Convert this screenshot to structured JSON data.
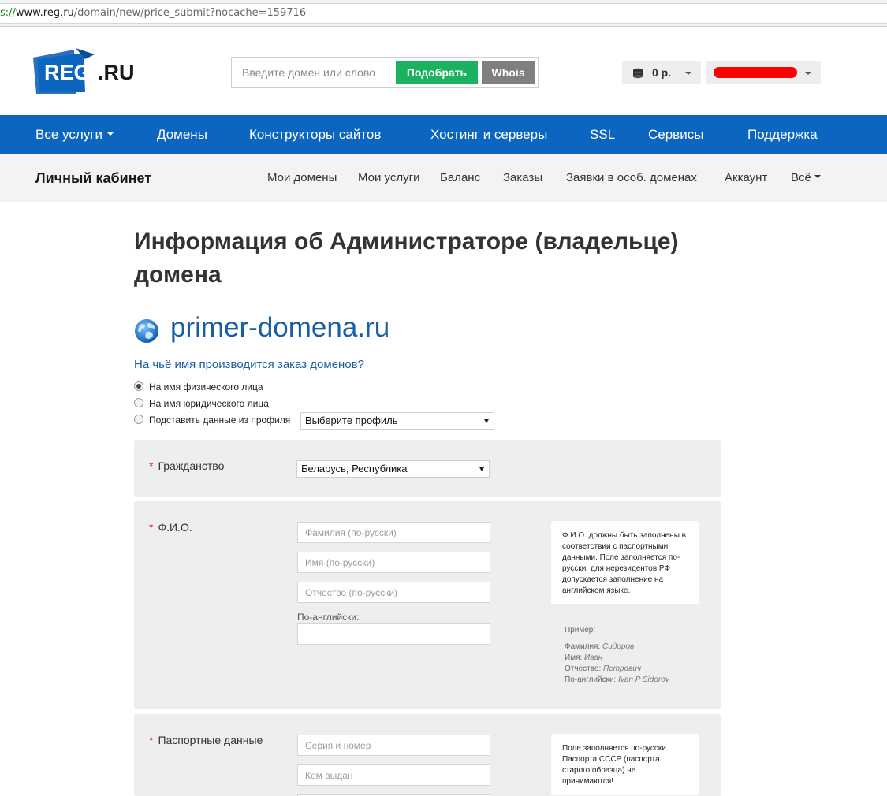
{
  "browser": {
    "url_scheme": "s://",
    "url_host": "www.reg.ru",
    "url_path": "/domain/new/price_submit?nocache=159716"
  },
  "header": {
    "logo_reg": "REG",
    "logo_ru": ".RU",
    "search_placeholder": "Введите домен или слово",
    "pick_button": "Подобрать",
    "whois_button": "Whois",
    "balance": "0 р."
  },
  "nav": {
    "items": [
      "Все услуги",
      "Домены",
      "Конструкторы сайтов",
      "Хостинг и серверы",
      "SSL",
      "Сервисы",
      "Поддержка"
    ]
  },
  "subnav": {
    "title": "Личный кабинет",
    "links": [
      "Мои домены",
      "Мои услуги",
      "Баланс",
      "Заказы",
      "Заявки в особ. доменах",
      "Аккаунт",
      "Всё"
    ]
  },
  "page": {
    "title_line1": "Информация об Администраторе (владельце)",
    "title_line2": "домена",
    "domain": "primer-domena.ru",
    "question": "На чьё имя производится заказ доменов?"
  },
  "owner_type": {
    "options": [
      "На имя физического лица",
      "На имя юридического лица",
      "Подставить данные из профиля"
    ],
    "selected_index": 0,
    "profile_select_value": "Выберите профиль"
  },
  "citizenship": {
    "label": "Гражданство",
    "value": "Беларусь, Республика"
  },
  "fio": {
    "label": "Ф.И.О.",
    "surname_placeholder": "Фамилия (по-русски)",
    "name_placeholder": "Имя (по-русски)",
    "patronymic_placeholder": "Отчество (по-русски)",
    "english_label": "По-английски:",
    "hint": "Ф.И.О. должны быть заполнены в соответствии с паспортными данными. Поле заполняется по-русски, для нерезидентов РФ допускается заполнение на английском языке.",
    "example_title": "Пример:",
    "example": [
      {
        "key": "Фамилия:",
        "value": "Сидоров"
      },
      {
        "key": "Имя:",
        "value": "Иван"
      },
      {
        "key": "Отчество:",
        "value": "Петрович"
      },
      {
        "key": "По-английски:",
        "value": "Ivan P Sidorov"
      }
    ]
  },
  "passport": {
    "label": "Паспортные данные",
    "series_placeholder": "Серия и номер",
    "issued_placeholder": "Кем выдан",
    "hint": "Поле заполняется по-русски. Паспорта СССР (паспорта старого образца) не принимаются!"
  },
  "colors": {
    "nav_blue": "#0c66c0",
    "green_button": "#1ab25f",
    "gray_button": "#7f7f7f",
    "link_blue": "#1a5fa3",
    "required_red": "#d9312c"
  }
}
